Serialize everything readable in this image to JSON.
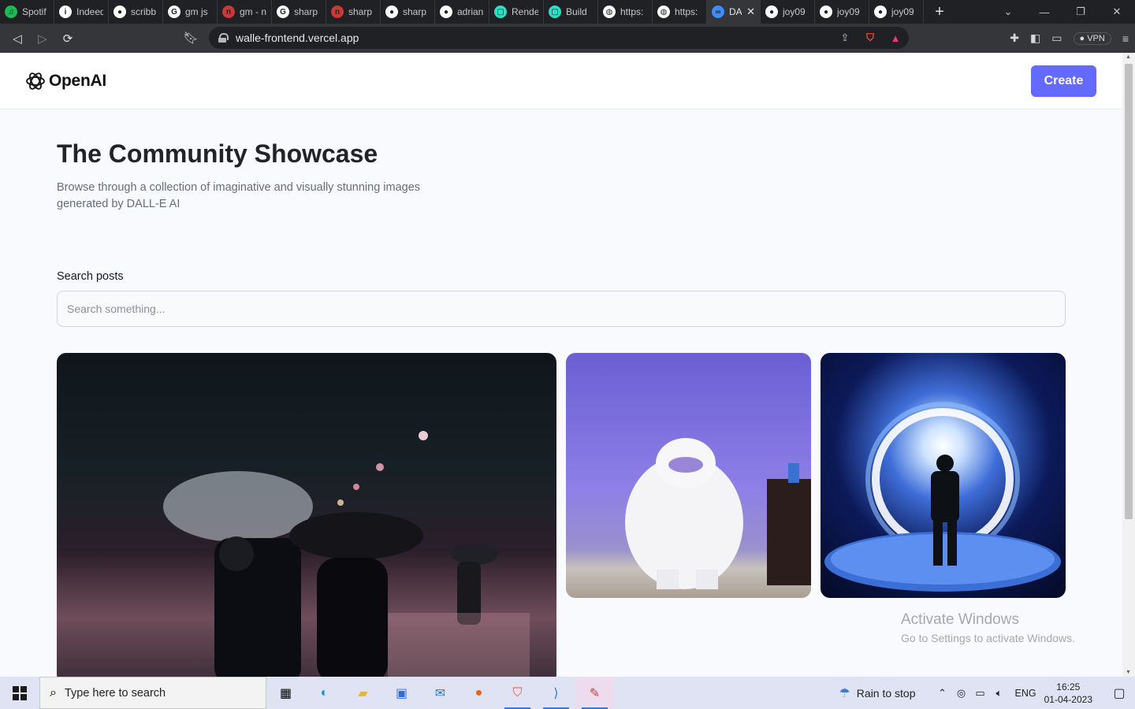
{
  "browser": {
    "tabs": [
      {
        "title": "Spotif",
        "icon": "spotify-icon",
        "color": "#1db954",
        "glyph": "♫"
      },
      {
        "title": "Indeed",
        "icon": "info-icon",
        "color": "#ffffff",
        "glyph": "i"
      },
      {
        "title": "scribb",
        "icon": "github-icon",
        "color": "#ffffff",
        "glyph": "●"
      },
      {
        "title": "gm js",
        "icon": "google-icon",
        "color": "#ffffff",
        "glyph": "G"
      },
      {
        "title": "gm - n",
        "icon": "npm-icon",
        "color": "#cb3837",
        "glyph": "n"
      },
      {
        "title": "sharp",
        "icon": "google-icon",
        "color": "#ffffff",
        "glyph": "G"
      },
      {
        "title": "sharp",
        "icon": "npm-icon",
        "color": "#cb3837",
        "glyph": "n"
      },
      {
        "title": "sharp",
        "icon": "github-icon",
        "color": "#ffffff",
        "glyph": "●"
      },
      {
        "title": "adrian",
        "icon": "github-icon",
        "color": "#ffffff",
        "glyph": "●"
      },
      {
        "title": "Rende",
        "icon": "render-icon",
        "color": "#2de0c4",
        "glyph": "▢"
      },
      {
        "title": "Build",
        "icon": "render-icon",
        "color": "#2de0c4",
        "glyph": "▢"
      },
      {
        "title": "https:",
        "icon": "globe-icon",
        "color": "#ffffff",
        "glyph": "◍"
      },
      {
        "title": "https:",
        "icon": "globe-icon",
        "color": "#ffffff",
        "glyph": "◍"
      },
      {
        "title": "DA",
        "icon": "dalle-icon",
        "color": "#3f8cff",
        "glyph": "∞",
        "active": true
      },
      {
        "title": "joy09",
        "icon": "github-icon",
        "color": "#ffffff",
        "glyph": "●"
      },
      {
        "title": "joy09",
        "icon": "github-icon",
        "color": "#ffffff",
        "glyph": "●"
      },
      {
        "title": "joy09",
        "icon": "github-icon",
        "color": "#ffffff",
        "glyph": "●"
      }
    ],
    "url": "walle-frontend.vercel.app",
    "vpn_label": "VPN"
  },
  "header": {
    "logo_text": "OpenAI",
    "create_label": "Create",
    "accent_color": "#6469ff"
  },
  "main": {
    "title": "The Community Showcase",
    "subtitle": "Browse through a collection of imaginative and visually stunning images generated by DALL-E AI",
    "search_label": "Search posts",
    "search_placeholder": "Search something...",
    "search_value": ""
  },
  "watermark": {
    "line1": "Activate Windows",
    "line2": "Go to Settings to activate Windows."
  },
  "taskbar": {
    "search_placeholder": "Type here to search",
    "weather": "Rain to stop",
    "lang": "ENG",
    "time": "16:25",
    "date": "01-04-2023"
  }
}
